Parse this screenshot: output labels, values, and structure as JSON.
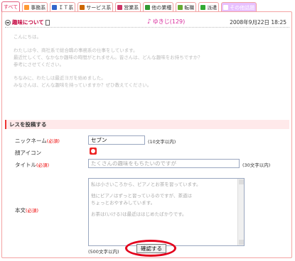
{
  "tabs": [
    {
      "label": "すべて",
      "active": true,
      "color": "#e03060"
    },
    {
      "label": "事務系",
      "icon": "pencil-icon",
      "color": "#ff9933"
    },
    {
      "label": "ＩＴ系",
      "icon": "monitor-icon",
      "color": "#3366cc"
    },
    {
      "label": "サービス系",
      "icon": "coffee-icon",
      "color": "#cc6600"
    },
    {
      "label": "営業系",
      "icon": "briefcase-icon",
      "color": "#cc3366"
    },
    {
      "label": "他の業種",
      "icon": "globe-icon",
      "color": "#339933"
    },
    {
      "label": "転職",
      "icon": "book-icon",
      "color": "#66aa33"
    },
    {
      "label": "派遣",
      "icon": "person-icon",
      "color": "#33aa33"
    },
    {
      "label": "その他話題",
      "icon": "folder-icon",
      "color": "#cc88ff"
    }
  ],
  "thread": {
    "title": "趣味について",
    "author": "ゆきじ(129)",
    "date": "2008年9月22日  18:25",
    "body": [
      "こんにちは。",
      "",
      "わたしは今、商社系で総合職の事務系の仕事をしています。",
      "最近忙しくて、なかなか趣味の時間がとれません。皆さんは、どんな趣味をお持ちですか？",
      "参考にさせてください。",
      "",
      "ちなみに、わたしは最近ヨガを始めました。",
      "みなさんは、どんな趣味を持っていますか？ぜひ教えてください。"
    ]
  },
  "reply": {
    "header": "レスを投稿する",
    "nickname_label": "ニックネーム",
    "nickname_req": "(必須)",
    "nickname_value": "セブン",
    "nickname_hint": "(10文字以内)",
    "face_label": "顔アイコン",
    "title_label": "タイトル",
    "title_req": "(必須)",
    "title_value": "たくさんの趣味をもちたいのですが",
    "title_hint": "(30文字以内)",
    "body_label": "本文",
    "body_req": "(必須)",
    "body_lines": [
      "私は小さいころから、ピアノとお茶を習っています。",
      "",
      "他にピアノはずっと習っているのですが、茶道は",
      "ちょっとおやすみしています。",
      "",
      "お茶は(いける)は最近ははじめたばかりです。"
    ],
    "body_hint": "(500文字以内)",
    "confirm_label": "確認する"
  }
}
